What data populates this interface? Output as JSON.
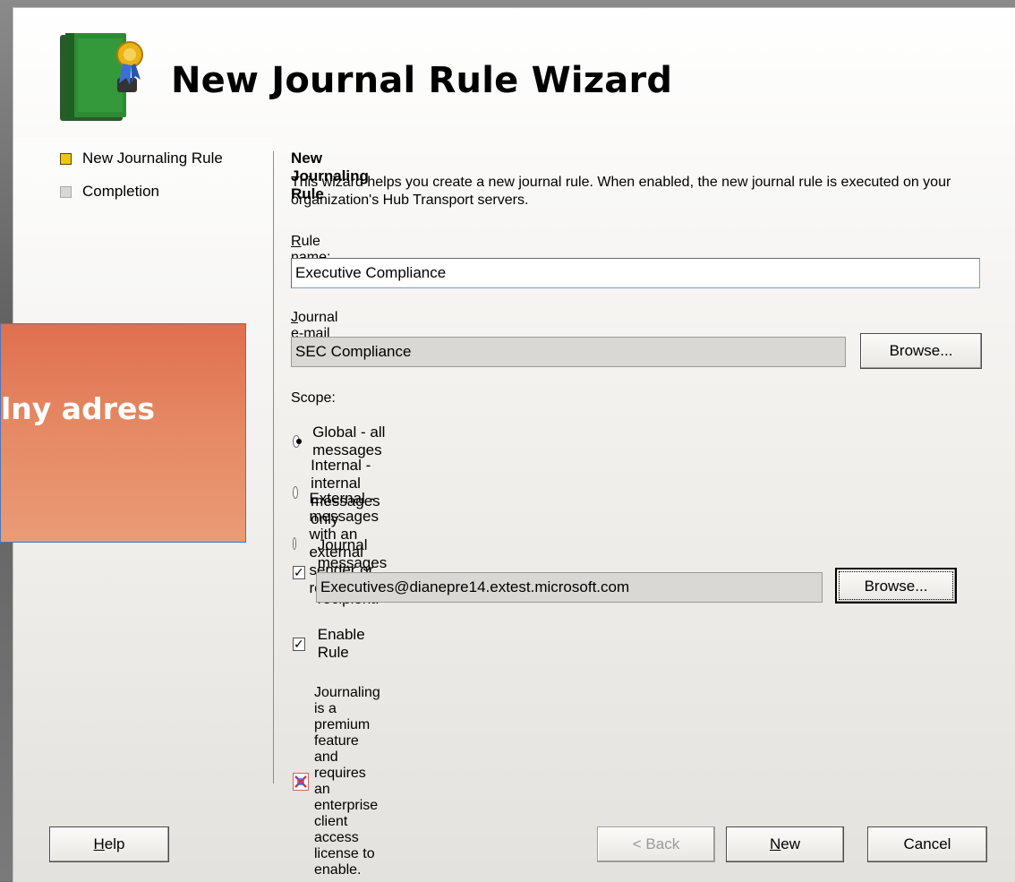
{
  "wizard": {
    "title": "New Journal Rule Wizard",
    "nav": [
      {
        "label": "New Journaling Rule",
        "state": "active"
      },
      {
        "label": "Completion",
        "state": "inactive"
      }
    ]
  },
  "page": {
    "heading": "New Journaling Rule",
    "description": "This wizard helps you create a new journal rule. When enabled, the new journal rule is executed on your organization's Hub Transport servers.",
    "rule_name_label": "Rule name:",
    "rule_name_value": "Executive Compliance",
    "journal_address_label": "Journal e-mail address:",
    "journal_address_value": "SEC Compliance",
    "browse_label": "Browse...",
    "scope_label": "Scope:",
    "scope_options": [
      {
        "label": "Global - all messages",
        "checked": true
      },
      {
        "label": "Internal - internal messages only",
        "checked": false
      },
      {
        "label": "External - messages with an external sender or recipient",
        "checked": false
      }
    ],
    "recipient_check_label": "Journal messages for recipient:",
    "recipient_value": "Executives@dianepre14.extest.microsoft.com",
    "recipient_browse_label": "Browse...",
    "enable_rule_label": "Enable Rule",
    "license_note": "Journaling is a premium feature and requires an enterprise client access license to enable."
  },
  "footer": {
    "help": "Help",
    "back": "< Back",
    "new": "New",
    "cancel": "Cancel"
  },
  "overlay": {
    "text": "lny adres"
  }
}
